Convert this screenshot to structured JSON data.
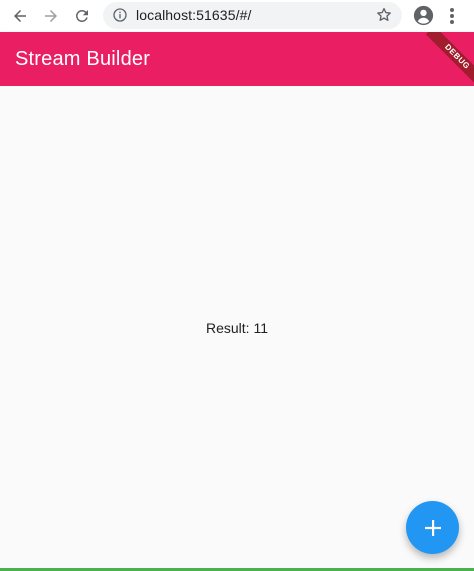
{
  "browser": {
    "url": "localhost:51635/#/",
    "icons": [
      "back-arrow-icon",
      "forward-arrow-icon",
      "reload-icon",
      "info-icon",
      "star-icon",
      "account-icon",
      "more-vert-icon"
    ]
  },
  "app_bar": {
    "title": "Stream Builder",
    "banner": "DEBUG",
    "color": "#e91e63"
  },
  "content": {
    "result_text": "Result: 11"
  },
  "fab": {
    "icon": "add-icon",
    "color": "#2196f3"
  }
}
